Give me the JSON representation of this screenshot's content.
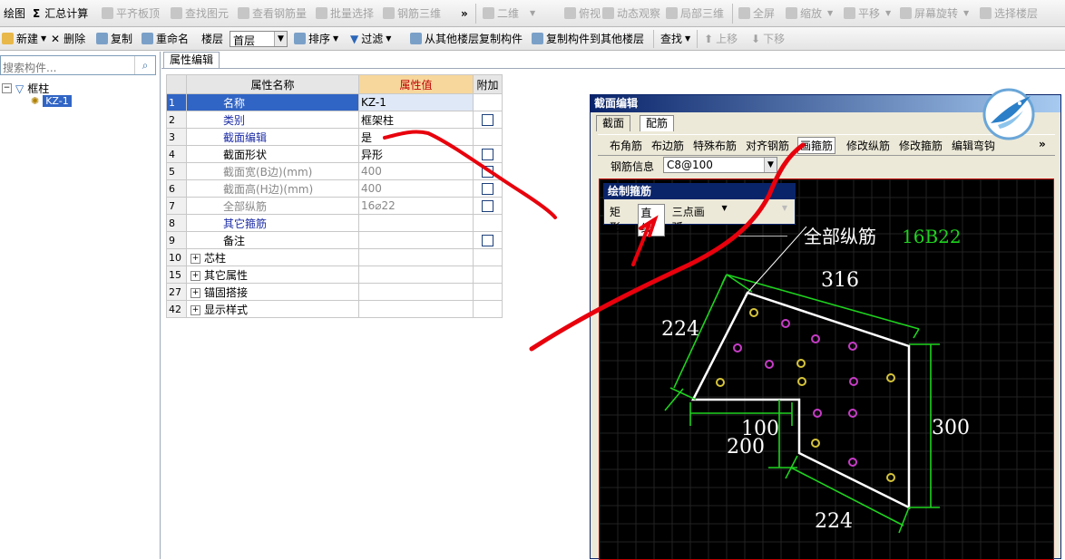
{
  "toolbar1": {
    "items": [
      {
        "label": "绘图",
        "enabled": true,
        "icon": "none"
      },
      {
        "label": "汇总计算",
        "enabled": true,
        "icon": "sigma-icon",
        "glyph": "Σ"
      },
      {
        "label": "平齐板顶",
        "enabled": false,
        "icon": "hammer-icon"
      },
      {
        "label": "查找图元",
        "enabled": false,
        "icon": "search-icon"
      },
      {
        "label": "查看钢筋量",
        "enabled": false,
        "icon": "rebar-icon"
      },
      {
        "label": "批量选择",
        "enabled": false,
        "icon": "select-icon"
      },
      {
        "label": "钢筋三维",
        "enabled": false,
        "icon": "cube-icon"
      }
    ],
    "overflow": "»",
    "right_items": [
      {
        "label": "二维",
        "enabled": false
      },
      {
        "label": "俯视",
        "enabled": false
      },
      {
        "label": "动态观察",
        "enabled": false
      },
      {
        "label": "局部三维",
        "enabled": false
      },
      {
        "label": "全屏",
        "enabled": false
      },
      {
        "label": "缩放",
        "enabled": false
      },
      {
        "label": "平移",
        "enabled": false
      },
      {
        "label": "屏幕旋转",
        "enabled": false
      },
      {
        "label": "选择楼层",
        "enabled": false
      }
    ]
  },
  "toolbar2": {
    "new": "新建",
    "delete": "删除",
    "copy": "复制",
    "rename": "重命名",
    "floor_label": "楼层",
    "floor_value": "首层",
    "sort": "排序",
    "filter": "过滤",
    "copy_from_other": "从其他楼层复制构件",
    "copy_to_other": "复制构件到其他楼层",
    "find": "查找",
    "move_up": "上移",
    "move_down": "下移"
  },
  "left_panel": {
    "search_placeholder": "搜索构件...",
    "tree_root": "框柱",
    "tree_child": "KZ-1"
  },
  "property_tab": "属性编辑",
  "grid": {
    "headers": {
      "name": "属性名称",
      "value": "属性值",
      "extra": "附加"
    },
    "rows": [
      {
        "num": "1",
        "name": "名称",
        "value": "KZ-1",
        "check": false,
        "style": "sel"
      },
      {
        "num": "2",
        "name": "类别",
        "value": "框架柱",
        "check": true,
        "style": "blue"
      },
      {
        "num": "3",
        "name": "截面编辑",
        "value": "是",
        "check": false,
        "style": "blue"
      },
      {
        "num": "4",
        "name": "截面形状",
        "value": "异形",
        "check": true,
        "style": "normal"
      },
      {
        "num": "5",
        "name": "截面宽(B边)(mm)",
        "value": "400",
        "check": true,
        "style": "gray"
      },
      {
        "num": "6",
        "name": "截面高(H边)(mm)",
        "value": "400",
        "check": true,
        "style": "gray"
      },
      {
        "num": "7",
        "name": "全部纵筋",
        "value": "16⌀22",
        "check": true,
        "style": "gray"
      },
      {
        "num": "8",
        "name": "其它箍筋",
        "value": "",
        "check": false,
        "style": "blue"
      },
      {
        "num": "9",
        "name": "备注",
        "value": "",
        "check": true,
        "style": "normal"
      },
      {
        "num": "10",
        "name": "芯柱",
        "value": "",
        "check": false,
        "style": "group"
      },
      {
        "num": "15",
        "name": "其它属性",
        "value": "",
        "check": false,
        "style": "group"
      },
      {
        "num": "27",
        "name": "锚固搭接",
        "value": "",
        "check": false,
        "style": "group"
      },
      {
        "num": "42",
        "name": "显示样式",
        "value": "",
        "check": false,
        "style": "group"
      }
    ]
  },
  "dialog": {
    "title": "截面编辑",
    "tabs": [
      "截面",
      "配筋"
    ],
    "rebar_tools": [
      "布角筋",
      "布边筋",
      "特殊布筋",
      "对齐钢筋",
      "画箍筋",
      "修改纵筋",
      "修改箍筋",
      "编辑弯钩"
    ],
    "rebar_info_label": "钢筋信息",
    "rebar_info_value": "C8@100",
    "draw_tools": {
      "title": "绘制箍筋",
      "items": [
        "矩形",
        "直线",
        "三点画弧"
      ]
    },
    "canvas": {
      "annotation_text": "全部纵筋",
      "annotation_value": "16B22",
      "dims": [
        "316",
        "224",
        "300",
        "224",
        "100",
        "200"
      ]
    }
  },
  "colors": {
    "accent": "#3165c5",
    "value_header": "#f7d79c",
    "dim_green": "#1fd31f",
    "scribble_red": "#e8000c"
  }
}
